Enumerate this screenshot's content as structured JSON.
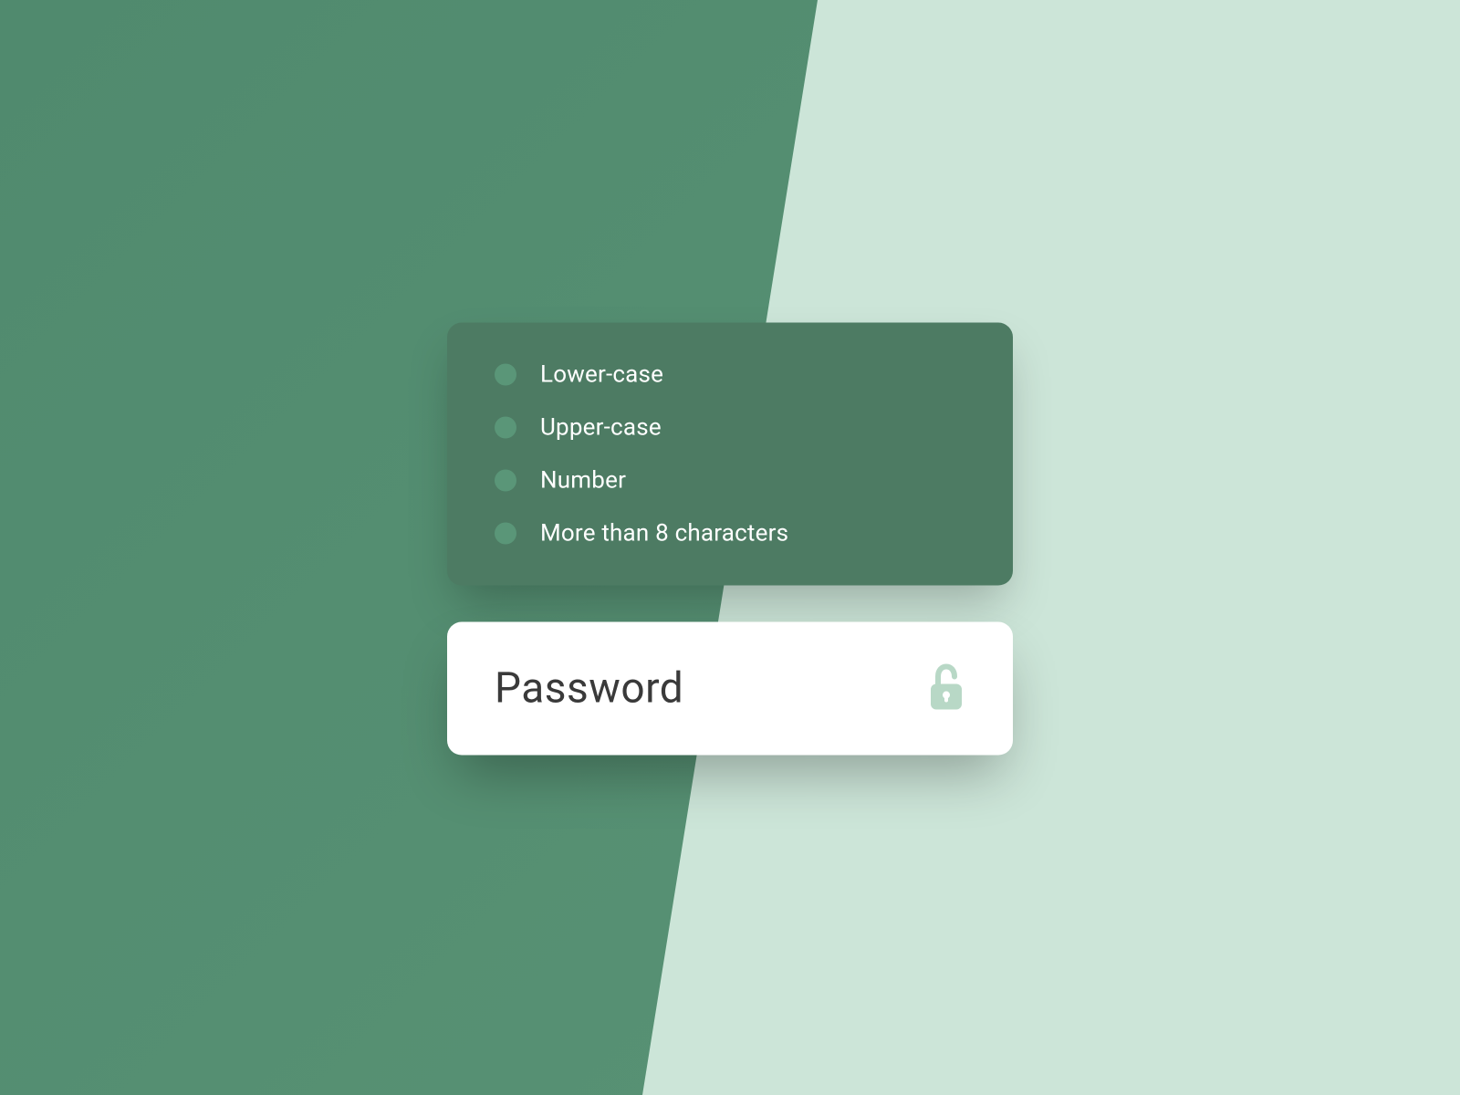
{
  "requirements": {
    "items": [
      {
        "label": "Lower-case"
      },
      {
        "label": "Upper-case"
      },
      {
        "label": "Number"
      },
      {
        "label": "More than 8 characters"
      }
    ]
  },
  "password_field": {
    "placeholder": "Password",
    "value": ""
  },
  "colors": {
    "bg_dark": "#508a6e",
    "bg_light": "#cce5d8",
    "card_dark": "#4d7b63",
    "dot": "#5a9678",
    "lock_icon": "#b8d8c6"
  }
}
